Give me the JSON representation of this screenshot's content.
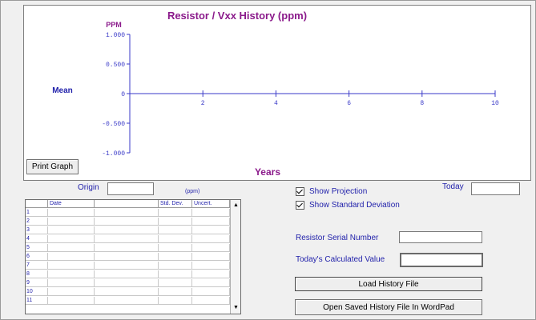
{
  "graph": {
    "title": "Resistor / Vxx History (ppm)",
    "y_unit_label": "PPM",
    "y_axis_label": "Mean",
    "x_axis_label": "Years",
    "print_button": "Print Graph"
  },
  "chart_data": {
    "type": "line",
    "title": "Resistor / Vxx History (ppm)",
    "xlabel": "Years",
    "ylabel": "Mean",
    "xlim": [
      0,
      10
    ],
    "ylim": [
      -1.0,
      1.0
    ],
    "x_ticks": [
      "2",
      "4",
      "6",
      "8",
      "10"
    ],
    "y_ticks": [
      "1.000",
      "0.500",
      "0",
      "-0.500",
      "-1.000"
    ],
    "series": []
  },
  "origin": {
    "label": "Origin",
    "value": ""
  },
  "ppm_label": "(ppm)",
  "table": {
    "columns": [
      "Date",
      "",
      "Std. Dev.",
      "Uncert."
    ],
    "row_numbers": [
      "1",
      "2",
      "3",
      "4",
      "5",
      "6",
      "7",
      "8",
      "9",
      "10",
      "11"
    ]
  },
  "options": {
    "show_projection": "Show Projection",
    "show_std_dev": "Show Standard Deviation"
  },
  "today": {
    "label": "Today",
    "value": ""
  },
  "serial": {
    "label": "Resistor Serial Number",
    "value": ""
  },
  "calc": {
    "label": "Today's Calculated Value",
    "value": ""
  },
  "buttons": {
    "load": "Load History File",
    "open_wordpad": "Open Saved History File In WordPad"
  },
  "colors": {
    "title": "#8b1a8b",
    "axis": "#3a3ac8",
    "label": "#1f1faa"
  }
}
